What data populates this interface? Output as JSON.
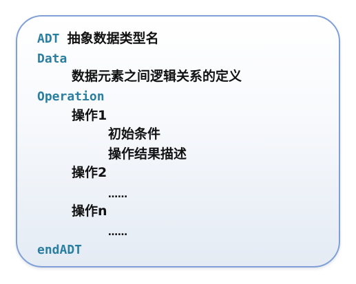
{
  "slide": {
    "adt_keyword": "ADT",
    "adt_name": "抽象数据类型名",
    "data_keyword": "Data",
    "data_definition": "数据元素之间逻辑关系的定义",
    "operation_keyword": "Operation",
    "op1_label": "操作1",
    "op1_initial_condition": "初始条件",
    "op1_result_description": "操作结果描述",
    "op2_label": "操作2",
    "op2_ellipsis": "……",
    "opn_label": "操作n",
    "opn_ellipsis": "……",
    "end_keyword": "endADT"
  },
  "colors": {
    "keyword": "#2a7ea0",
    "text": "#111111",
    "border": "#7f9fd6"
  }
}
